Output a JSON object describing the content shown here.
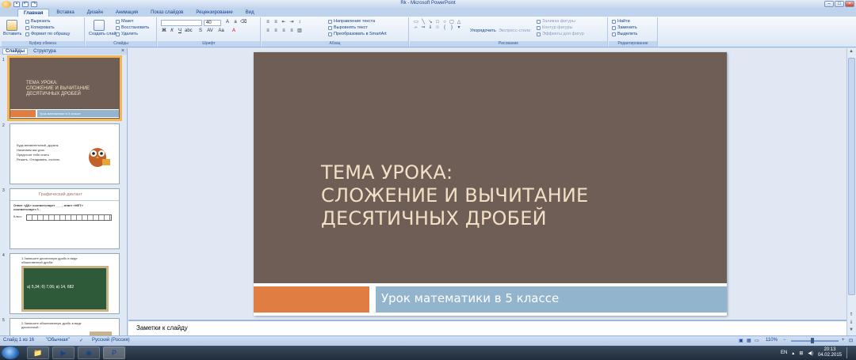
{
  "window": {
    "title": "Rk - Microsoft PowerPoint"
  },
  "tabs": [
    "Главная",
    "Вставка",
    "Дизайн",
    "Анимация",
    "Показ слайдов",
    "Рецензирование",
    "Вид"
  ],
  "ribbon": {
    "clipboard": {
      "paste": "Вставить",
      "cut": "Вырезать",
      "copy": "Копировать",
      "format_painter": "Формат по образцу",
      "label": "Буфер обмена"
    },
    "slides": {
      "new_slide": "Создать слайд",
      "layout": "Макет",
      "reset": "Восстановить",
      "delete": "Удалить",
      "label": "Слайды"
    },
    "font": {
      "size": "40",
      "label": "Шрифт"
    },
    "paragraph": {
      "text_direction": "Направление текста",
      "align_text": "Выровнять текст",
      "smartart": "Преобразовать в SmartArt",
      "label": "Абзац"
    },
    "drawing": {
      "arrange": "Упорядочить",
      "quick_styles": "Экспресс-стили",
      "fill": "Заливка фигуры",
      "outline": "Контур фигуры",
      "effects": "Эффекты для фигур",
      "label": "Рисование"
    },
    "editing": {
      "find": "Найти",
      "replace": "Заменить",
      "select": "Выделить",
      "label": "Редактирование"
    }
  },
  "left_panel": {
    "tabs": [
      "Слайды",
      "Структура"
    ],
    "thumbs": [
      {
        "num": "1",
        "title": "ТЕМА УРОКА:\nСЛОЖЕНИЕ И ВЫЧИТАНИЕ\nДЕСЯТИЧНЫХ ДРОБЕЙ",
        "sub": "Урок математики в 5 классе"
      },
      {
        "num": "2",
        "lines": [
          "Будь внимательный, дружок,",
          "Начинаем мы урок.",
          "Предстоит тебе опять",
          "Решать. Отгадывать, считать"
        ]
      },
      {
        "num": "3",
        "title": "Графический диктант",
        "line1": "Ответ «ДА» соответствует ___ , ответ «НЕТ»",
        "line2": "соответствует /\\ .",
        "line3": "Ключ:"
      },
      {
        "num": "4",
        "line1": "1.Запишите десятичную дробь в виде",
        "line2": "обыкновенной дроби:",
        "board": "а) 5,34;      б) 7,06;      в) 14, 682"
      },
      {
        "num": "5",
        "line1": "2.Запишите обыкновенную дробь в виде",
        "line2": "десятичной :"
      }
    ]
  },
  "slide": {
    "title": "ТЕМА УРОКА:\n СЛОЖЕНИЕ И ВЫЧИТАНИЕ\nДЕСЯТИЧНЫХ ДРОБЕЙ",
    "subtitle": "Урок математики в 5 классе"
  },
  "notes": {
    "placeholder": "Заметки к слайду"
  },
  "status": {
    "slide_info": "Слайд 1 из 16",
    "theme": "\"Обычная\"",
    "language": "Русский (Россия)",
    "zoom": "110%"
  },
  "taskbar": {
    "lang": "EN",
    "time": "20:13",
    "date": "04.02.2015"
  }
}
